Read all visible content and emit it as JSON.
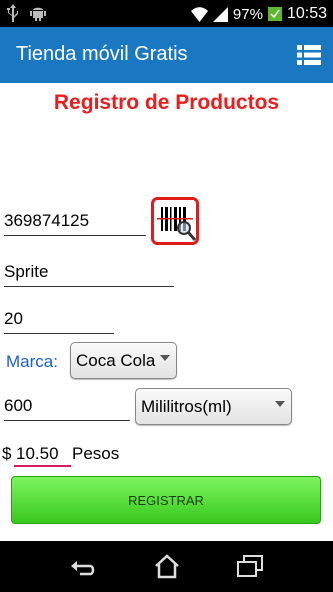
{
  "status": {
    "battery": "97%",
    "time": "10:53"
  },
  "app": {
    "title": "Tienda móvil Gratis"
  },
  "form": {
    "heading": "Registro de Productos",
    "barcode": "369874125",
    "name": "Sprite",
    "quantity": "20",
    "brand_label": "Marca:",
    "brand_value": "Coca Cola",
    "volume": "600",
    "unit_value": "Mililitros(ml)",
    "currency_symbol": "$",
    "price": "10.50",
    "currency_name": "Pesos",
    "register_label": "REGISTRAR"
  },
  "colors": {
    "action_bar": "#1a78c2",
    "heading": "#ee1c1c",
    "brand_label": "#1f5fd2",
    "register_button": "#4cd62e"
  },
  "icons": [
    "usb-icon",
    "android-icon",
    "wifi-icon",
    "signal-icon",
    "battery-icon",
    "menu-icon",
    "barcode-scan-icon",
    "back-icon",
    "home-icon",
    "recent-apps-icon"
  ]
}
